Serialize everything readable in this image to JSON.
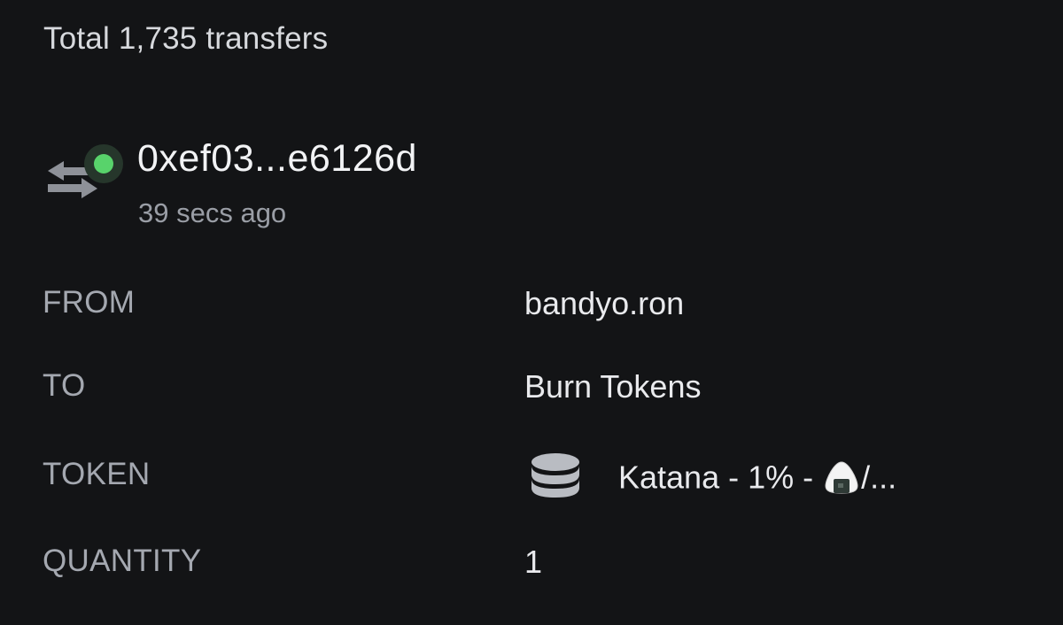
{
  "summary": {
    "total_label": "Total 1,735 transfers"
  },
  "transfer": {
    "hash": "0xef03...e6126d",
    "time_ago": "39 secs ago",
    "status_color": "#58d36b",
    "icon": "transfer-arrows-icon"
  },
  "details": {
    "from_label": "FROM",
    "from_value": "bandyo.ron",
    "to_label": "TO",
    "to_value": "Burn Tokens",
    "token_label": "TOKEN",
    "token_icon": "coin-stack-icon",
    "token_name_prefix": "Katana - 1% - ",
    "token_name_suffix": "/...",
    "token_emoji_icon": "rice-ball-icon",
    "quantity_label": "QUANTITY",
    "quantity_value": "1"
  }
}
